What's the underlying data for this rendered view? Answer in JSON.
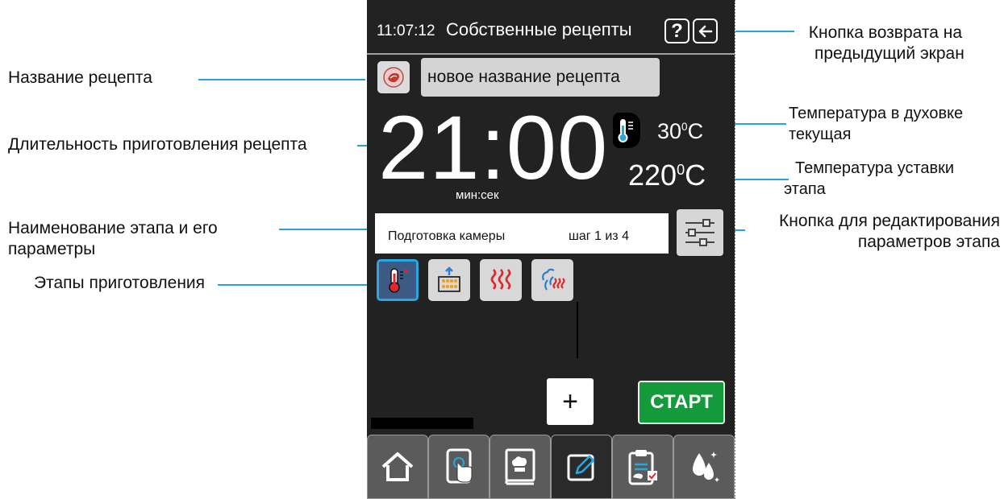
{
  "header": {
    "clock": "11:07:12",
    "title": "Собственные рецепты",
    "help_label": "?"
  },
  "recipe": {
    "name": "новое название рецепта"
  },
  "timer": {
    "value": "21:00",
    "unit": "мин:сек"
  },
  "temperatures": {
    "current_value": "30",
    "setpoint_value": "220",
    "deg_mark": "0",
    "unit": "C"
  },
  "step": {
    "name": "Подготовка камеры",
    "progress": "шаг 1 из 4"
  },
  "stages": [
    {
      "icon": "thermometer-preheat-icon",
      "active": true
    },
    {
      "icon": "tray-load-icon",
      "active": false
    },
    {
      "icon": "convection-heat-icon",
      "active": false
    },
    {
      "icon": "steam-heat-icon",
      "active": false
    }
  ],
  "buttons": {
    "add_label": "+",
    "start_label": "СТАРТ"
  },
  "tabs": [
    {
      "icon": "home-icon",
      "selected": false
    },
    {
      "icon": "touch-tablet-icon",
      "selected": false
    },
    {
      "icon": "recipe-book-icon",
      "selected": false
    },
    {
      "icon": "edit-pencil-icon",
      "selected": true
    },
    {
      "icon": "clipboard-check-icon",
      "selected": false
    },
    {
      "icon": "cleaning-drops-icon",
      "selected": false
    }
  ],
  "annotations": {
    "back_button_line1": "Кнопка возврата на",
    "back_button_line2": "предыдущий экран",
    "recipe_name": "Название рецепта",
    "duration": "Длительность приготовления рецепта",
    "oven_temp_line1": "Температура в духовке",
    "oven_temp_line2": "текущая",
    "setpoint_line1": "Температура уставки",
    "setpoint_line2": "этапа",
    "stage_name_line1": "Наименование этапа и его",
    "stage_name_line2": "параметры",
    "edit_params_line1": "Кнопка для редактирования",
    "edit_params_line2": "параметров этапа",
    "stages": "Этапы приготовления"
  },
  "colors": {
    "accent_blue": "#29a3d9",
    "start_green": "#139a3a",
    "heat_red": "#e0262a",
    "screen_bg": "#222222"
  }
}
